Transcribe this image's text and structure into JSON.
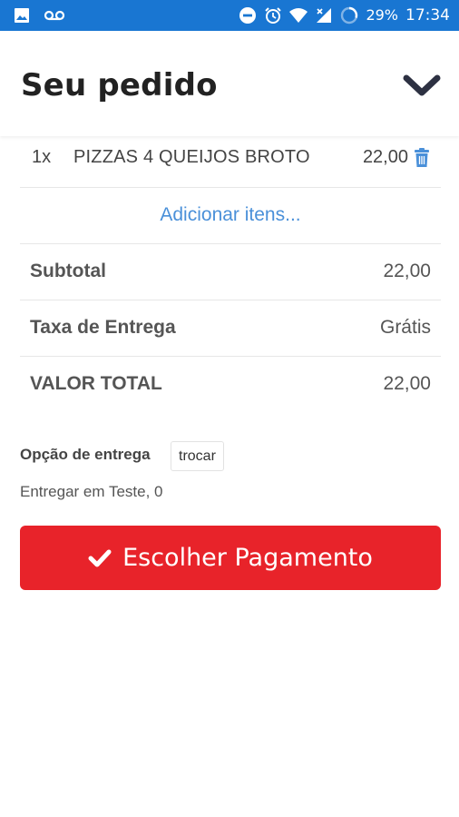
{
  "status_bar": {
    "battery": "29%",
    "time": "17:34",
    "icons": [
      "image-icon",
      "voicemail-icon",
      "dnd-icon",
      "alarm-icon",
      "wifi-icon",
      "signal-icon",
      "battery-ring-icon"
    ]
  },
  "header": {
    "title": "Seu pedido",
    "collapse_icon": "chevron-down-icon"
  },
  "order": {
    "items": [
      {
        "qty": "1x",
        "name": "PIZZAS 4 QUEIJOS BROTO",
        "price": "22,00",
        "icon": "trash-icon"
      }
    ],
    "add_items_label": "Adicionar itens..."
  },
  "summary": {
    "subtotal_label": "Subtotal",
    "subtotal_value": "22,00",
    "fee_label": "Taxa de Entrega",
    "fee_value": "Grátis",
    "total_label": "VALOR TOTAL",
    "total_value": "22,00"
  },
  "delivery": {
    "label": "Opção de entrega",
    "swap_label": "trocar",
    "address": "Entregar em Teste, 0"
  },
  "payment": {
    "button_label": "Escolher Pagamento",
    "icon": "check-icon"
  },
  "colors": {
    "status_bar": "#1976d2",
    "link": "#4a90d9",
    "trash": "#4a90d9",
    "primary_button": "#e8232a",
    "chevron": "#2d3142"
  }
}
